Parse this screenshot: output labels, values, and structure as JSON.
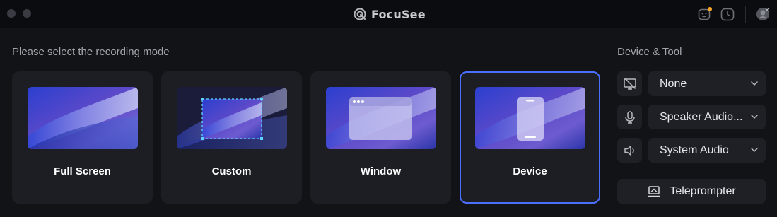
{
  "window": {
    "title": "FocuSee"
  },
  "main": {
    "prompt": "Please select the recording mode",
    "modes": [
      {
        "label": "Full Screen",
        "selected": false
      },
      {
        "label": "Custom",
        "selected": false
      },
      {
        "label": "Window",
        "selected": false
      },
      {
        "label": "Device",
        "selected": true
      }
    ]
  },
  "side": {
    "title": "Device & Tool",
    "camera": {
      "value": "None",
      "icon": "camera-off-icon"
    },
    "microphone": {
      "value": "Speaker Audio...",
      "icon": "microphone-icon"
    },
    "system_audio": {
      "value": "System Audio",
      "icon": "speaker-icon"
    },
    "teleprompter": {
      "label": "Teleprompter",
      "icon": "teleprompter-icon"
    }
  },
  "colors": {
    "accent": "#4a6fff",
    "notification": "#f5a623",
    "background": "#121317",
    "card": "#1d1e23"
  }
}
